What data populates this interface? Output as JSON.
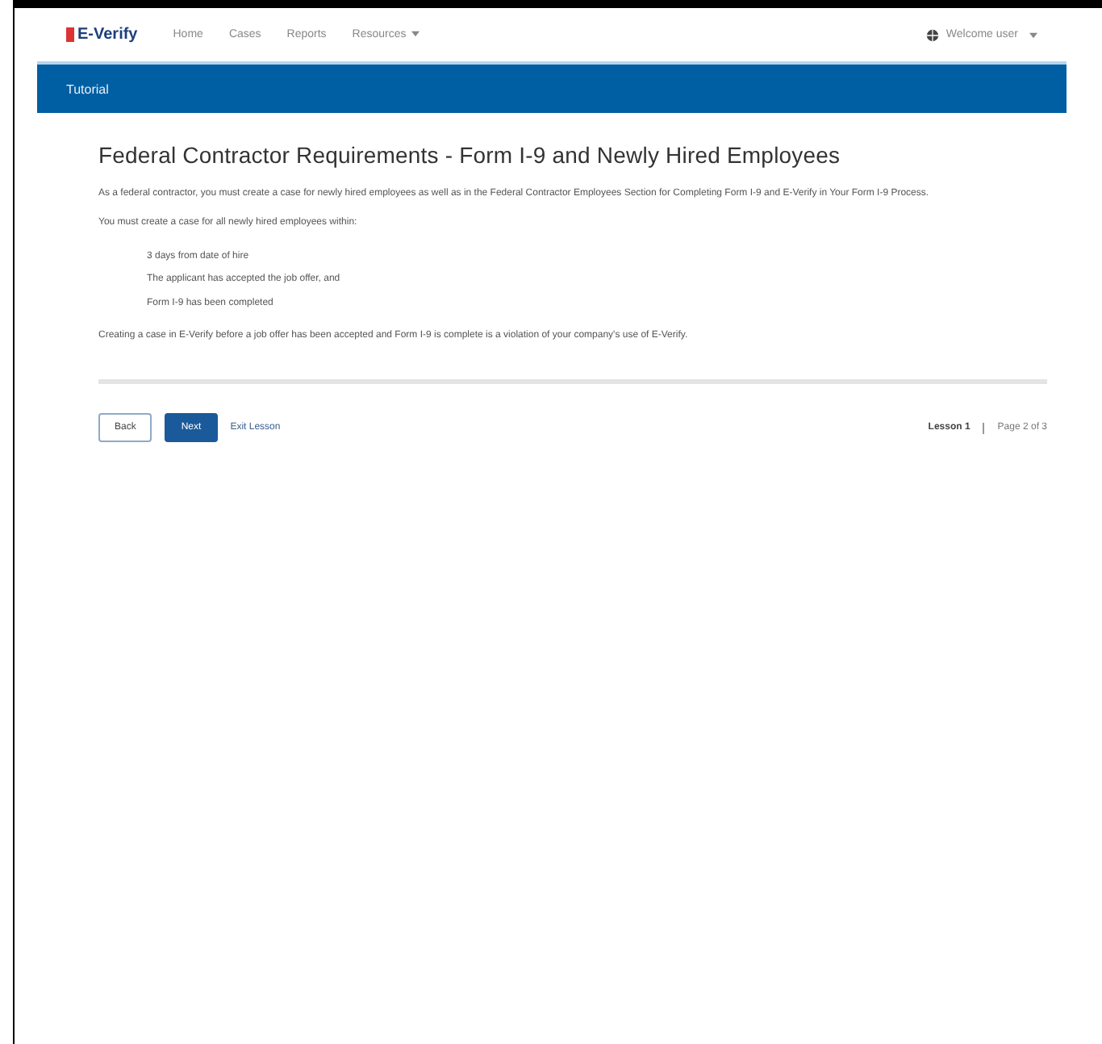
{
  "header": {
    "logo": "E-Verify",
    "nav": [
      {
        "label": "Home",
        "dropdown": false
      },
      {
        "label": "Cases",
        "dropdown": false
      },
      {
        "label": "Reports",
        "dropdown": false
      },
      {
        "label": "Resources",
        "dropdown": true
      }
    ],
    "user": "Welcome user"
  },
  "banner": {
    "title": "Tutorial"
  },
  "content": {
    "heading": "Federal Contractor Requirements - Form I-9 and Newly Hired Employees",
    "paragraphs": [
      "As a federal contractor, you must create a case for newly hired employees as well as in the Federal Contractor Employees Section for Completing Form I-9 and E-Verify in Your Form I-9 Process.",
      "You must create a case for all newly hired employees within:"
    ],
    "list": [
      "3 days from date of hire",
      "The applicant has accepted the job offer, and",
      "Form I-9 has been completed"
    ],
    "closing": "Creating a case in E-Verify before a job offer has been accepted and Form I-9 is complete is a violation of your company's use of E-Verify."
  },
  "footer": {
    "buttons": [
      {
        "label": "Back",
        "kind": "secondary"
      },
      {
        "label": "Next",
        "kind": "primary"
      }
    ],
    "link": "Exit Lesson",
    "lesson": "Lesson 1",
    "page": "Page 2 of 3"
  }
}
